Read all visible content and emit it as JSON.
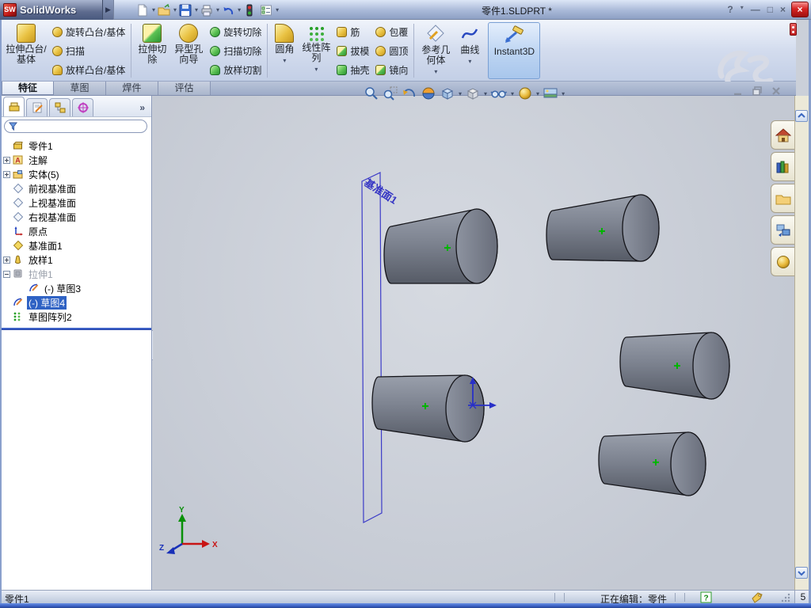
{
  "glyphs": {
    "dd": "▾",
    "more": "»",
    "brand_arrow": "▶",
    "collapse_left": "◂"
  },
  "titlebar": {
    "logo_text": "SW",
    "app_name": "SolidWorks",
    "doc_title": "零件1.SLDPRT *",
    "help": "?",
    "minimize": "—",
    "maximize": "□",
    "close": "×",
    "close_red": "×"
  },
  "ribbon": {
    "extrude_boss": "拉伸凸台/基体",
    "revolve_boss": "旋转凸台/基体",
    "sweep": "扫描",
    "loft_boss": "放样凸台/基体",
    "extrude_cut": "拉伸切除",
    "hole_wizard": "异型孔向导",
    "revolve_cut": "旋转切除",
    "sweep_cut": "扫描切除",
    "loft_cut": "放样切割",
    "fillet": "圆角",
    "linear_pattern": "线性阵列",
    "rib": "筋",
    "draft": "拔模",
    "shell": "抽壳",
    "wrap": "包覆",
    "dome": "圆顶",
    "mirror": "镜向",
    "reference_geometry": "参考几何体",
    "curves": "曲线",
    "instant3d": "Instant3D"
  },
  "tabs": {
    "features": "特征",
    "sketch": "草图",
    "weldments": "焊件",
    "evaluate": "评估"
  },
  "tree": {
    "items": [
      {
        "label": "零件1"
      },
      {
        "label": "注解"
      },
      {
        "label": "实体(5)"
      },
      {
        "label": "前视基准面"
      },
      {
        "label": "上视基准面"
      },
      {
        "label": "右视基准面"
      },
      {
        "label": "原点"
      },
      {
        "label": "基准面1"
      },
      {
        "label": "放样1"
      },
      {
        "label": "拉伸1"
      },
      {
        "label": "(-) 草图3"
      },
      {
        "label": "(-) 草图4"
      },
      {
        "label": "草图阵列2"
      }
    ]
  },
  "icons": {
    "annotations_letter": "A"
  },
  "viewport": {
    "plane_label": "基准面1",
    "triad_x": "X",
    "triad_y": "Y",
    "triad_z": "Z"
  },
  "statusbar": {
    "part_name": "零件1",
    "editing": "正在编辑：零件",
    "help_badge": "?",
    "page": "5"
  },
  "colors": {
    "selection": "#316ac5",
    "viewport_bg": "#cbd0d9",
    "cone_gray": "#7d8290",
    "plane_blue": "#3c3cc8",
    "point_green": "#00b400",
    "taskpane_beige": "#ece9d8",
    "close_red": "#d02020"
  }
}
